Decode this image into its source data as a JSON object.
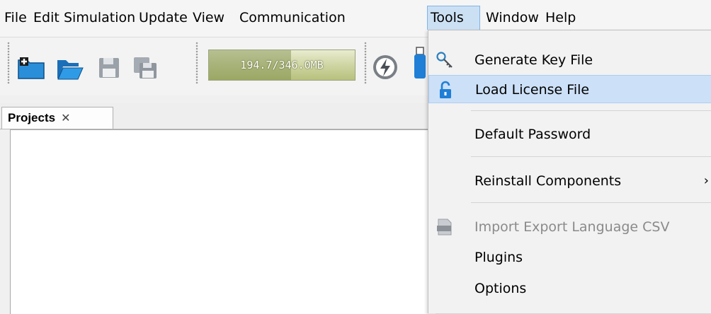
{
  "menubar": {
    "items": [
      "File",
      "Edit",
      "Simulation",
      "Update",
      "View",
      "Communication",
      "Tools",
      "Window",
      "Help"
    ],
    "active": "Tools"
  },
  "toolbar": {
    "buttons": [
      "new-project-icon",
      "open-folder-icon",
      "save-icon",
      "save-all-icon",
      "lightning-icon",
      "usb-device-icon"
    ],
    "memory": {
      "text": "194.7/346.0MB",
      "used_mb": 194.7,
      "total_mb": 346.0
    }
  },
  "projects": {
    "tab_label": "Projects",
    "close_glyph": "✕"
  },
  "tools_menu": {
    "items": [
      {
        "label": "Generate Key File",
        "icon": "key-icon",
        "state": "normal"
      },
      {
        "label": "Load License File",
        "icon": "unlock-icon",
        "state": "hover"
      },
      {
        "label": "Default Password",
        "state": "normal"
      },
      {
        "label": "Reinstall Components",
        "state": "normal",
        "submenu_glyph": "›"
      },
      {
        "label": "Import Export Language CSV",
        "icon": "csv-file-icon",
        "state": "disabled"
      },
      {
        "label": "Plugins",
        "state": "normal"
      },
      {
        "label": "Options",
        "state": "normal"
      }
    ]
  },
  "colors": {
    "menu_highlight": "#cce0f7",
    "accent_blue": "#1f7fd6",
    "memory_bar": "#cfd5a3"
  }
}
